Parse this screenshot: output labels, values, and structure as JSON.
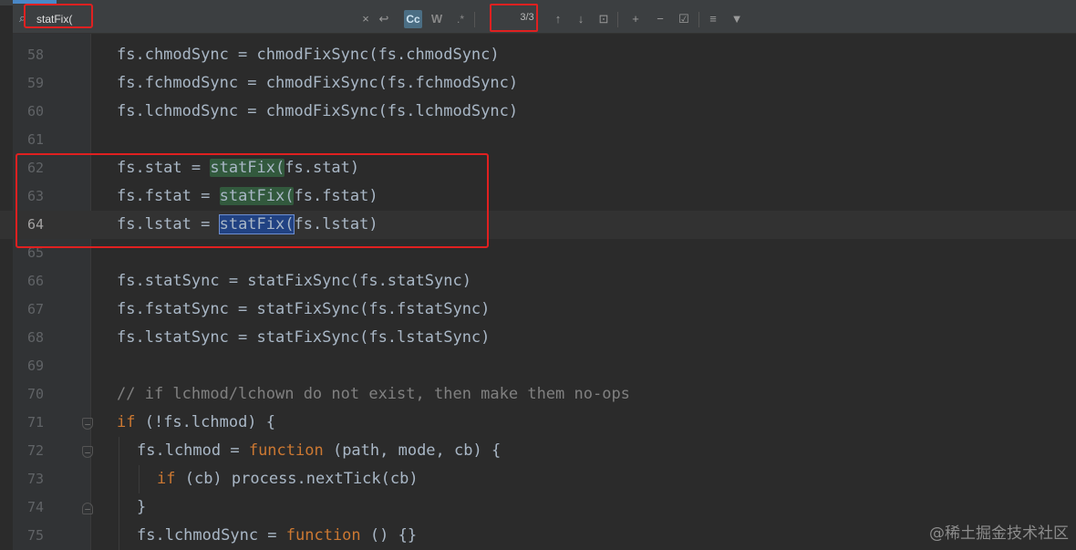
{
  "search": {
    "query": "statFix(",
    "match_count": "3/3",
    "case_toggle": "Cc",
    "word_toggle": "W",
    "regex_toggle": ".*",
    "clear_icon": "×",
    "history_icon": "↩",
    "prev_icon": "↑",
    "next_icon": "↓",
    "select_all_icon": "⊡",
    "add_sel_icon": "+",
    "remove_sel_icon": "−",
    "check_icon": "☑",
    "settings_icon": "≡",
    "filter_icon": "▼"
  },
  "lines": [
    {
      "n": "58",
      "code": "fs.chmodSync = chmodFixSync(fs.chmodSync)"
    },
    {
      "n": "59",
      "code": "fs.fchmodSync = chmodFixSync(fs.fchmodSync)"
    },
    {
      "n": "60",
      "code": "fs.lchmodSync = chmodFixSync(fs.lchmodSync)"
    },
    {
      "n": "61",
      "code": ""
    },
    {
      "n": "62",
      "pre": "fs.stat = ",
      "match": "statFix(",
      "post": "fs.stat)"
    },
    {
      "n": "63",
      "pre": "fs.fstat = ",
      "match": "statFix(",
      "post": "fs.fstat)"
    },
    {
      "n": "64",
      "pre": "fs.lstat = ",
      "match": "statFix(",
      "post": "fs.lstat)"
    },
    {
      "n": "65",
      "code": ""
    },
    {
      "n": "66",
      "code": "fs.statSync = statFixSync(fs.statSync)"
    },
    {
      "n": "67",
      "code": "fs.fstatSync = statFixSync(fs.fstatSync)"
    },
    {
      "n": "68",
      "code": "fs.lstatSync = statFixSync(fs.lstatSync)"
    },
    {
      "n": "69",
      "code": ""
    },
    {
      "n": "70",
      "comment": "// if lchmod/lchown do not exist, then make them no-ops"
    },
    {
      "n": "71",
      "kw": "if",
      "rest": " (!fs.lchmod) {"
    },
    {
      "n": "72",
      "pre": "fs.lchmod = ",
      "kw": "function",
      "rest": " (path, mode, cb) {"
    },
    {
      "n": "73",
      "kw": "if",
      "rest": " (cb) process.nextTick(cb)"
    },
    {
      "n": "74",
      "code": "}"
    },
    {
      "n": "75",
      "pre": "fs.lchmodSync = ",
      "kw": "function",
      "rest": " () {}"
    }
  ],
  "watermark": "@稀土掘金技术社区"
}
